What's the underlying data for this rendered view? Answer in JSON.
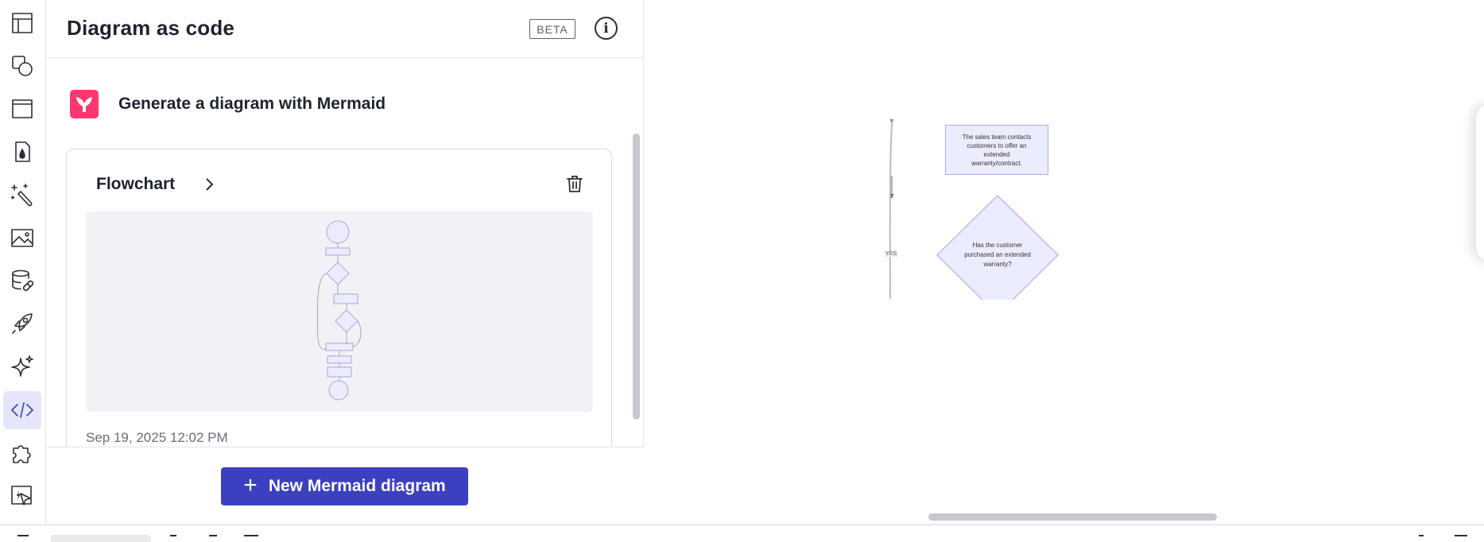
{
  "panel": {
    "title": "Diagram as code",
    "beta_label": "BETA",
    "info_glyph": "i",
    "generate_text": "Generate a diagram with Mermaid",
    "card": {
      "title": "Flowchart",
      "date": "Sep 19, 2025 12:02 PM"
    },
    "new_button_label": "New Mermaid diagram"
  },
  "canvas": {
    "node_lines": [
      "The sales team contacts",
      "customers to offer an",
      "extended",
      "warranty/contract."
    ],
    "decision_lines": [
      "Has the customer",
      "purchased an extended",
      "warranty?"
    ],
    "edge_label": "YES"
  },
  "rail": {
    "icons": [
      "frame-icon",
      "shapes-icon",
      "card-icon",
      "ink-icon",
      "magic-wand-icon",
      "image-icon",
      "database-link-icon",
      "rocket-icon",
      "sparkle-icon",
      "code-icon",
      "puzzle-icon",
      "smart-select-icon"
    ],
    "active": "code-icon"
  },
  "colors": {
    "accent": "#3c3fc0",
    "mermaid_brand": "#ff3670",
    "node_fill": "#ececff",
    "node_stroke": "#9370db"
  }
}
